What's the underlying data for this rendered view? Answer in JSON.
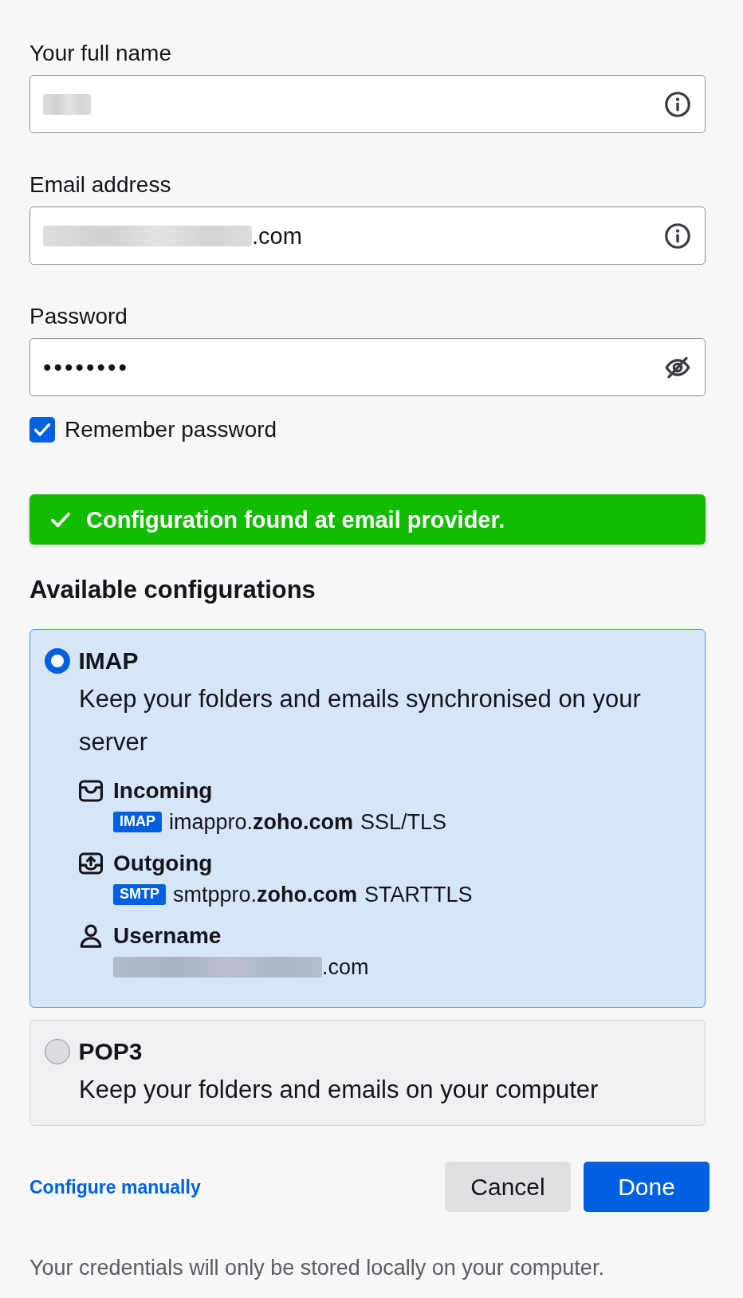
{
  "fields": [
    {
      "kind": "name",
      "label": "Your full name",
      "redacted": true
    },
    {
      "kind": "email",
      "label": "Email address",
      "value": ".com",
      "redacted": true
    },
    {
      "kind": "password",
      "label": "Password",
      "value": "••••••••"
    }
  ],
  "remember": {
    "label": "Remember password",
    "checked": true
  },
  "banner": {
    "kind": "success",
    "text": "Configuration found at email provider."
  },
  "configurations": {
    "heading": "Available configurations",
    "options": [
      {
        "name": "IMAP",
        "description": "Keep your folders and emails synchronised on your server",
        "selected": true,
        "details": [
          {
            "kind": "incoming",
            "title": "Incoming",
            "protocol": "IMAP",
            "host": "imappro.**zoho.com**",
            "security": "SSL/TLS"
          },
          {
            "kind": "outgoing",
            "title": "Outgoing",
            "protocol": "SMTP",
            "host": "smtppro.**zoho.com**",
            "security": "STARTTLS"
          },
          {
            "kind": "username",
            "title": "Username",
            "value": ".com",
            "redacted": true
          }
        ]
      },
      {
        "name": "POP3",
        "description": "Keep your folders and emails on your computer",
        "selected": false
      }
    ]
  },
  "footer": {
    "link": "Configure manually",
    "buttons": [
      {
        "label": "Cancel",
        "kind": "secondary"
      },
      {
        "label": "Done",
        "kind": "primary"
      }
    ],
    "note": "Your credentials will only be stored locally on your computer."
  }
}
